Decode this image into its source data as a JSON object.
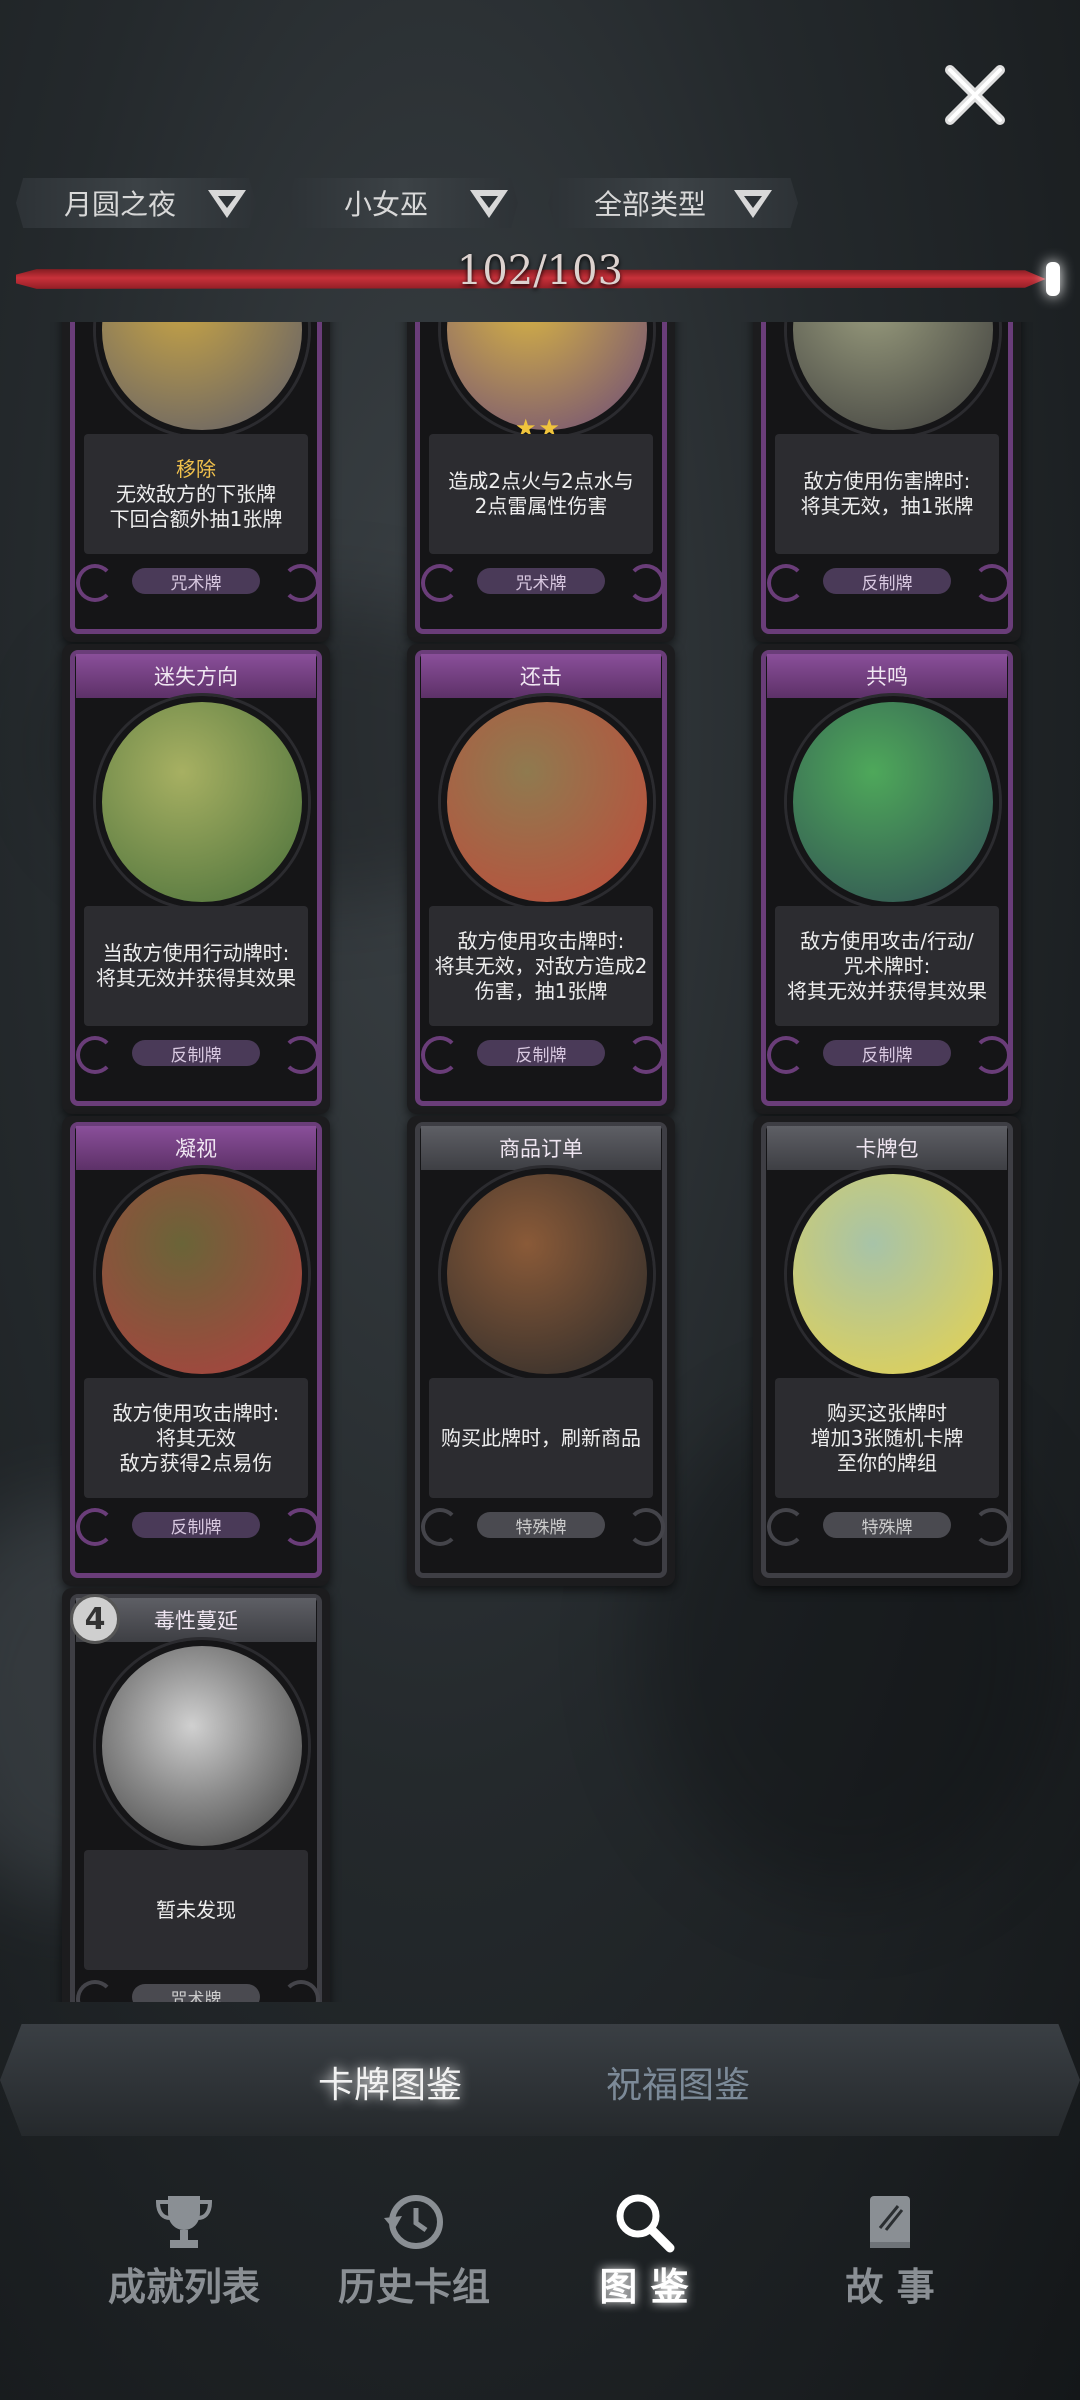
{
  "filters": [
    {
      "label": "月圆之夜"
    },
    {
      "label": "小女巫"
    },
    {
      "label": "全部类型"
    }
  ],
  "progress": {
    "text": "102/103",
    "fraction": 0.99
  },
  "cards": [
    {
      "name": "",
      "desc_parts": [
        [
          "移除",
          "hl"
        ],
        [
          "无效敌方的下张牌",
          ""
        ],
        [
          "下回合额外抽1张牌",
          ""
        ]
      ],
      "type": "咒术牌"
    },
    {
      "name": "",
      "desc_parts": [
        [
          "造成2点火与2点水与",
          ""
        ],
        [
          "2点雷属性伤害",
          ""
        ]
      ],
      "type": "咒术牌",
      "stars": "★★"
    },
    {
      "name": "",
      "desc_parts": [
        [
          "敌方使用伤害牌时:",
          ""
        ],
        [
          "将其无效，抽1张牌",
          ""
        ]
      ],
      "type": "反制牌"
    },
    {
      "name": "迷失方向",
      "desc_parts": [
        [
          "当敌方使用行动牌时:",
          ""
        ],
        [
          "将其无效并获得其效果",
          ""
        ]
      ],
      "type": "反制牌"
    },
    {
      "name": "还击",
      "desc_parts": [
        [
          "敌方使用攻击牌时:",
          ""
        ],
        [
          "将其无效，对敌方造成2",
          ""
        ],
        [
          "伤害，抽1张牌",
          ""
        ]
      ],
      "type": "反制牌"
    },
    {
      "name": "共鸣",
      "desc_parts": [
        [
          "敌方使用攻击/行动/",
          ""
        ],
        [
          "咒术牌时:",
          ""
        ],
        [
          "将其无效并获得其效果",
          ""
        ]
      ],
      "type": "反制牌"
    },
    {
      "name": "凝视",
      "desc_parts": [
        [
          "敌方使用攻击牌时:",
          ""
        ],
        [
          "将其无效",
          ""
        ],
        [
          "敌方获得2点易伤",
          "mix"
        ]
      ],
      "type": "反制牌"
    },
    {
      "name": "商品订单",
      "desc_parts": [
        [
          "购买此牌时，刷新商品",
          ""
        ]
      ],
      "type": "特殊牌"
    },
    {
      "name": "卡牌包",
      "desc_parts": [
        [
          "购买这张牌时",
          ""
        ],
        [
          "增加3张随机卡牌",
          ""
        ],
        [
          "至你的牌组",
          ""
        ]
      ],
      "type": "特殊牌"
    },
    {
      "name": "毒性蔓延",
      "desc_parts": [
        [
          "暂未发现",
          ""
        ]
      ],
      "type": "咒术牌",
      "cost": "4"
    }
  ],
  "tabs": [
    {
      "label": "卡牌图鉴",
      "active": true
    },
    {
      "label": "祝福图鉴",
      "active": false
    }
  ],
  "nav": [
    {
      "label": "成就列表",
      "icon": "trophy-icon"
    },
    {
      "label": "历史卡组",
      "icon": "history-icon"
    },
    {
      "label": "图 鉴",
      "icon": "magnifier-icon",
      "active": true
    },
    {
      "label": "故 事",
      "icon": "book-icon"
    }
  ]
}
